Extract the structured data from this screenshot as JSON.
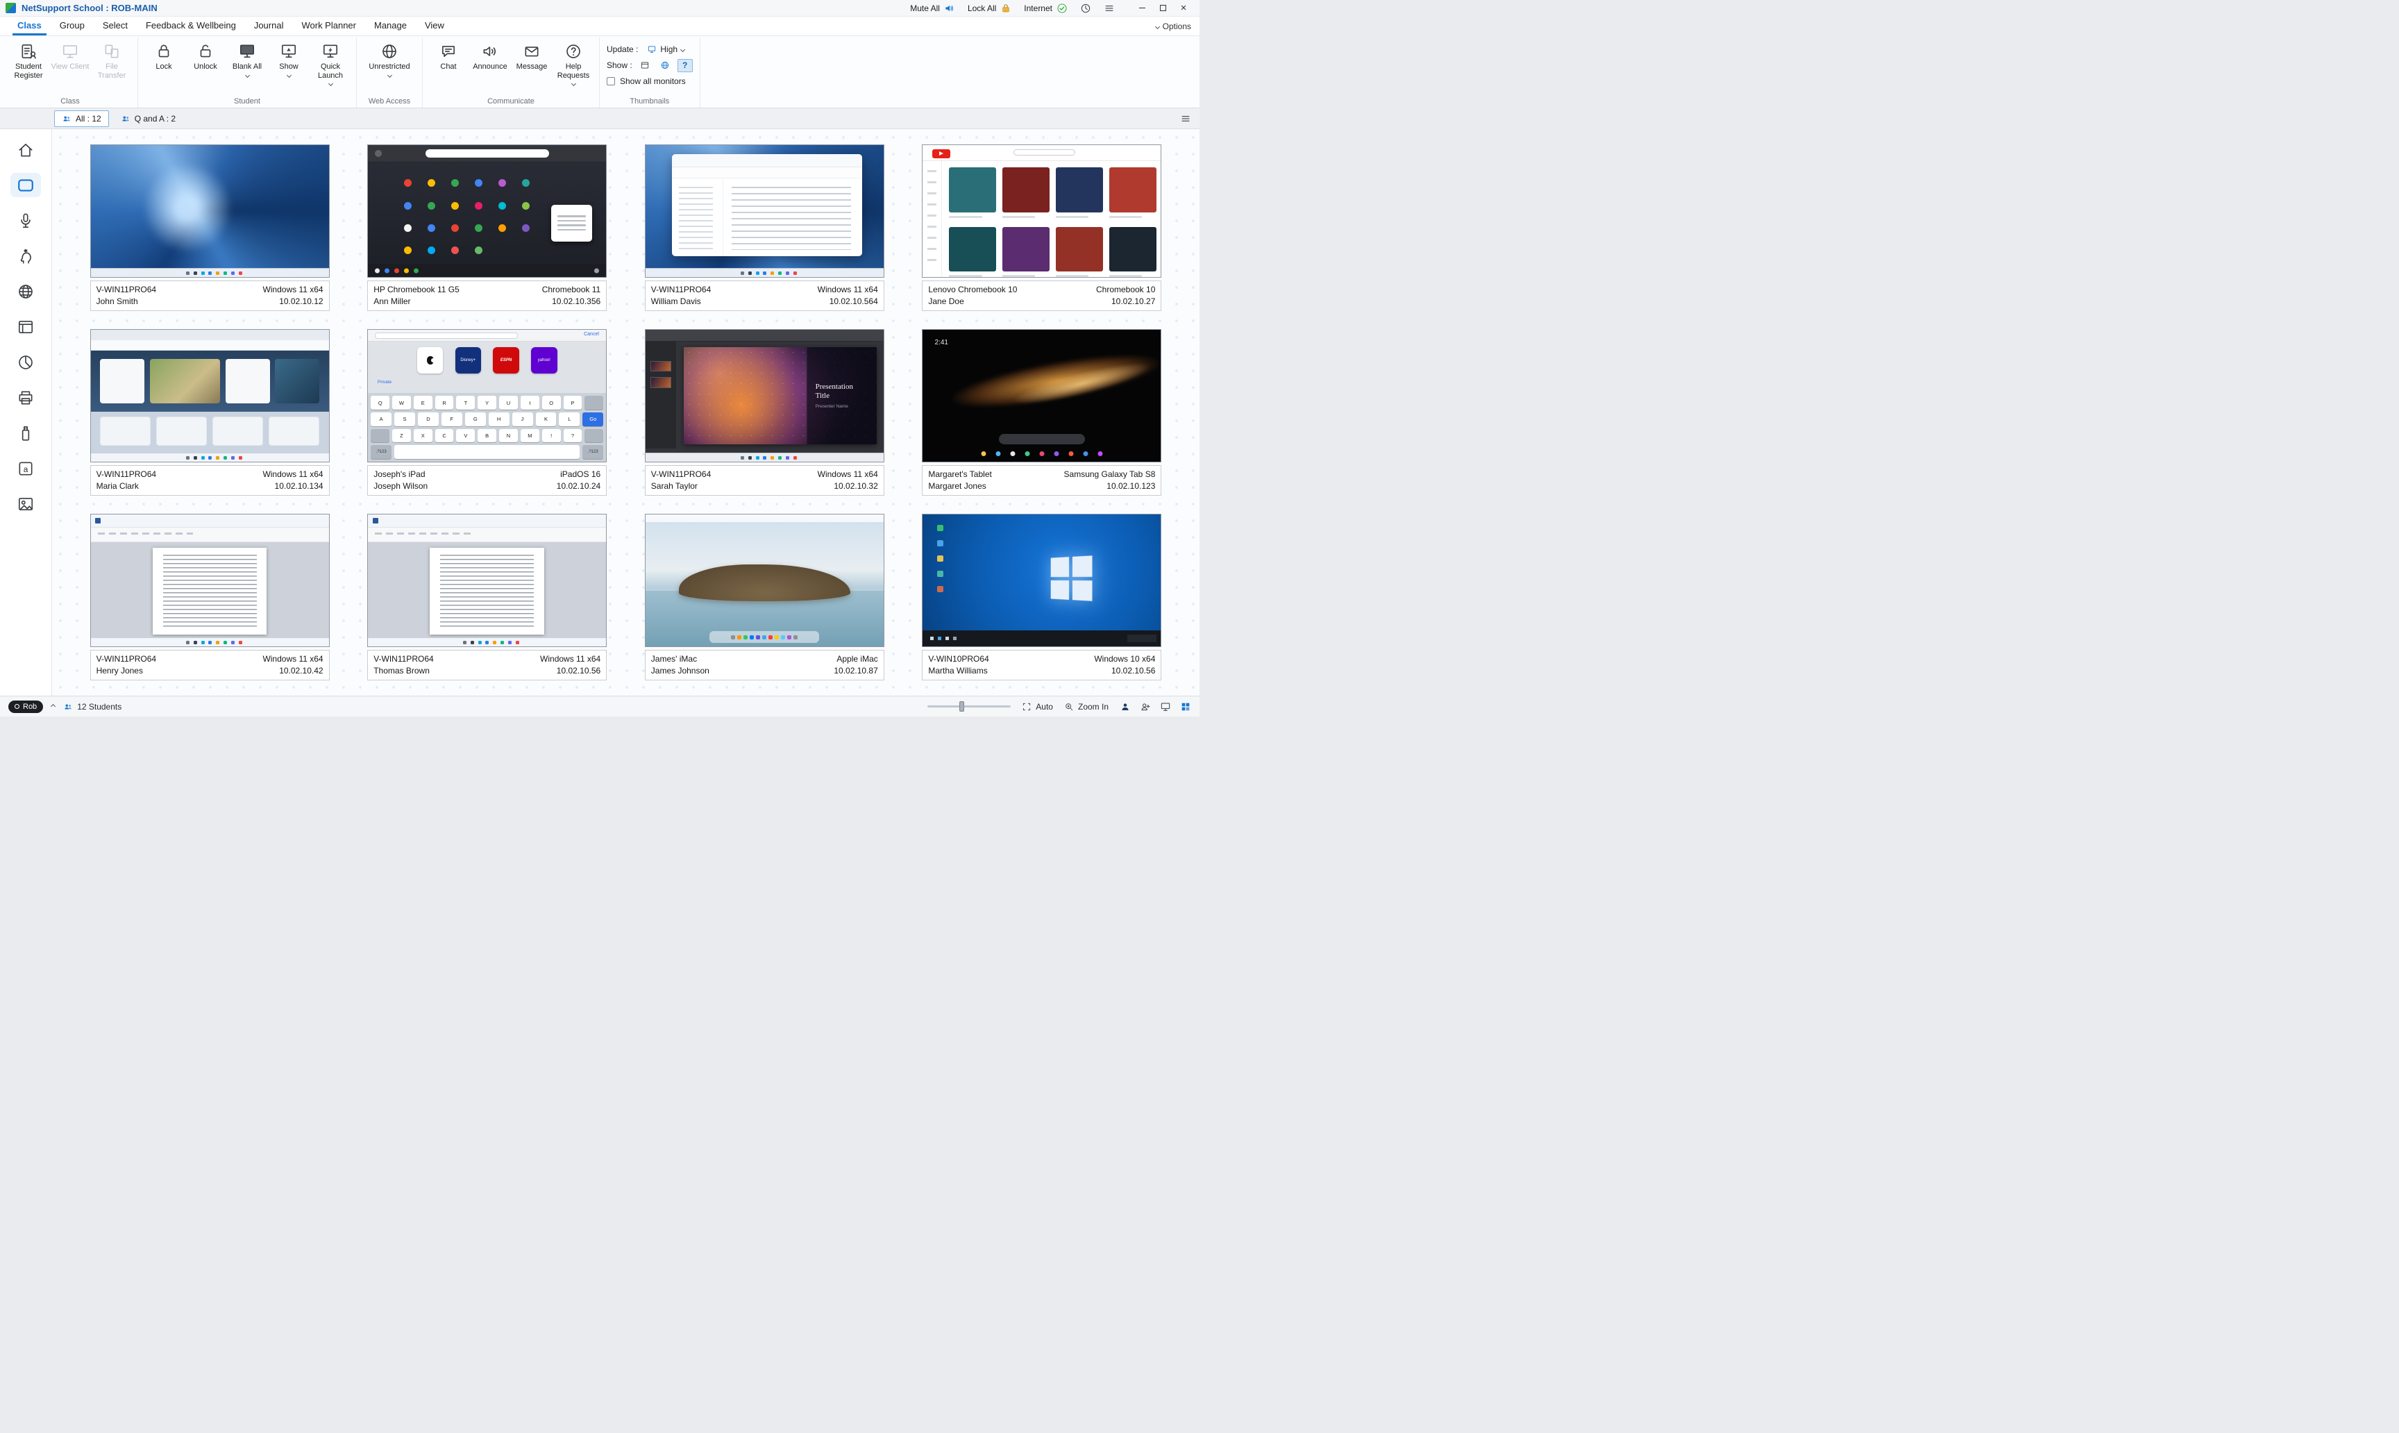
{
  "titlebar": {
    "title": "NetSupport School : ROB-MAIN",
    "mute_all": "Mute All",
    "lock_all": "Lock All",
    "internet": "Internet"
  },
  "menu": {
    "tabs": [
      "Class",
      "Group",
      "Select",
      "Feedback & Wellbeing",
      "Journal",
      "Work Planner",
      "Manage",
      "View"
    ],
    "active_tab": "Class",
    "options": "Options"
  },
  "ribbon": {
    "class_group": {
      "name": "Class",
      "student_register": "Student Register",
      "view_client": "View Client",
      "file_transfer": "File Transfer"
    },
    "student_group": {
      "name": "Student",
      "lock": "Lock",
      "unlock": "Unlock",
      "blank_all": "Blank All",
      "show": "Show",
      "quick_launch": "Quick Launch"
    },
    "web_group": {
      "name": "Web Access",
      "unrestricted": "Unrestricted"
    },
    "communicate_group": {
      "name": "Communicate",
      "chat": "Chat",
      "announce": "Announce",
      "message": "Message",
      "help_requests": "Help Requests"
    },
    "thumbnails_group": {
      "name": "Thumbnails",
      "update_label": "Update :",
      "update_value": "High",
      "show_label": "Show :",
      "show_all_monitors": "Show all monitors"
    }
  },
  "view_tabs": {
    "all": "All : 12",
    "qa": "Q and A : 2"
  },
  "statusbar": {
    "user": "Rob",
    "students": "12 Students",
    "auto": "Auto",
    "zoom_in": "Zoom In"
  },
  "students": [
    {
      "machine": "V-WIN11PRO64",
      "person": "John Smith",
      "os": "Windows 11 x64",
      "ip": "10.02.10.12",
      "type": "win11bloom"
    },
    {
      "machine": "HP Chromebook 11 G5",
      "person": "Ann Miller",
      "os": "Chromebook 11",
      "ip": "10.02.10.356",
      "type": "chromeos"
    },
    {
      "machine": "V-WIN11PRO64",
      "person": "William Davis",
      "os": "Windows 11 x64",
      "ip": "10.02.10.564",
      "type": "win11explorer"
    },
    {
      "machine": "Lenovo Chromebook 10",
      "person": "Jane Doe",
      "os": "Chromebook 10",
      "ip": "10.02.10.27",
      "type": "youtube"
    },
    {
      "machine": "V-WIN11PRO64",
      "person": "Maria Clark",
      "os": "Windows 11 x64",
      "ip": "10.02.10.134",
      "type": "edge"
    },
    {
      "machine": "Joseph's iPad",
      "person": "Joseph Wilson",
      "os": "iPadOS 16",
      "ip": "10.02.10.24",
      "type": "ipad",
      "scene": {
        "cancel": "Cancel",
        "private": "Private",
        "go": "Go",
        "row1": "QWERTYUIOP",
        "row2": "ASDFGHJKL",
        "row3": "ZXCVBNM",
        "punct1": "!",
        "punct2": "?",
        "num_key": ".?123",
        "apps": [
          "Disney+",
          "ESPN",
          "yahoo!"
        ]
      }
    },
    {
      "machine": "V-WIN11PRO64",
      "person": "Sarah Taylor",
      "os": "Windows 11 x64",
      "ip": "10.02.10.32",
      "type": "powerpoint",
      "scene": {
        "title": "Presentation Title",
        "subtitle": "Presenter Name"
      }
    },
    {
      "machine": "Margaret's Tablet",
      "person": "Margaret Jones",
      "os": "Samsung Galaxy Tab S8",
      "ip": "10.02.10.123",
      "type": "samsungtab",
      "scene": {
        "clock": "2:41"
      }
    },
    {
      "machine": "V-WIN11PRO64",
      "person": "Henry Jones",
      "os": "Windows 11 x64",
      "ip": "10.02.10.42",
      "type": "word"
    },
    {
      "machine": "V-WIN11PRO64",
      "person": "Thomas Brown",
      "os": "Windows 11 x64",
      "ip": "10.02.10.56",
      "type": "word"
    },
    {
      "machine": "James' iMac",
      "person": "James Johnson",
      "os": "Apple iMac",
      "ip": "10.02.10.87",
      "type": "imac"
    },
    {
      "machine": "V-WIN10PRO64",
      "person": "Martha Williams",
      "os": "Windows 10 x64",
      "ip": "10.02.10.56",
      "type": "win10"
    }
  ]
}
